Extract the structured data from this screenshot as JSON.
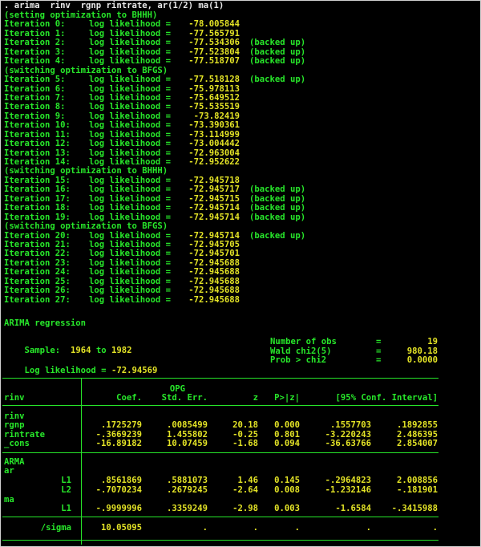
{
  "command": ". arima  rinv  rgnp rintrate, ar(1/2) ma(1)",
  "colors": {
    "background": "#000000",
    "command": "#e8e8e8",
    "text": "#27e62a",
    "result": "#e3e326"
  },
  "log_label": "log likelihood =",
  "backed_label": "(backed up)",
  "iteration_log": [
    {
      "kind": "header",
      "text": "(setting optimization to BHHH)"
    },
    {
      "kind": "iter",
      "label": "Iteration 0:",
      "value": "-78.005844",
      "backed": false
    },
    {
      "kind": "iter",
      "label": "Iteration 1:",
      "value": "-77.565791",
      "backed": false
    },
    {
      "kind": "iter",
      "label": "Iteration 2:",
      "value": "-77.534306",
      "backed": true
    },
    {
      "kind": "iter",
      "label": "Iteration 3:",
      "value": "-77.523804",
      "backed": true
    },
    {
      "kind": "iter",
      "label": "Iteration 4:",
      "value": "-77.518707",
      "backed": true
    },
    {
      "kind": "header",
      "text": "(switching optimization to BFGS)"
    },
    {
      "kind": "iter",
      "label": "Iteration 5:",
      "value": "-77.518128",
      "backed": true
    },
    {
      "kind": "iter",
      "label": "Iteration 6:",
      "value": "-75.978113",
      "backed": false
    },
    {
      "kind": "iter",
      "label": "Iteration 7:",
      "value": "-75.649512",
      "backed": false
    },
    {
      "kind": "iter",
      "label": "Iteration 8:",
      "value": "-75.535519",
      "backed": false
    },
    {
      "kind": "iter",
      "label": "Iteration 9:",
      "value": "-73.82419",
      "backed": false
    },
    {
      "kind": "iter",
      "label": "Iteration 10:",
      "value": "-73.390361",
      "backed": false
    },
    {
      "kind": "iter",
      "label": "Iteration 11:",
      "value": "-73.114999",
      "backed": false
    },
    {
      "kind": "iter",
      "label": "Iteration 12:",
      "value": "-73.004442",
      "backed": false
    },
    {
      "kind": "iter",
      "label": "Iteration 13:",
      "value": "-72.963004",
      "backed": false
    },
    {
      "kind": "iter",
      "label": "Iteration 14:",
      "value": "-72.952622",
      "backed": false
    },
    {
      "kind": "header",
      "text": "(switching optimization to BHHH)"
    },
    {
      "kind": "iter",
      "label": "Iteration 15:",
      "value": "-72.945718",
      "backed": false
    },
    {
      "kind": "iter",
      "label": "Iteration 16:",
      "value": "-72.945717",
      "backed": true
    },
    {
      "kind": "iter",
      "label": "Iteration 17:",
      "value": "-72.945715",
      "backed": true
    },
    {
      "kind": "iter",
      "label": "Iteration 18:",
      "value": "-72.945714",
      "backed": true
    },
    {
      "kind": "iter",
      "label": "Iteration 19:",
      "value": "-72.945714",
      "backed": true
    },
    {
      "kind": "header",
      "text": "(switching optimization to BFGS)"
    },
    {
      "kind": "iter",
      "label": "Iteration 20:",
      "value": "-72.945714",
      "backed": true
    },
    {
      "kind": "iter",
      "label": "Iteration 21:",
      "value": "-72.945705",
      "backed": false
    },
    {
      "kind": "iter",
      "label": "Iteration 22:",
      "value": "-72.945701",
      "backed": false
    },
    {
      "kind": "iter",
      "label": "Iteration 23:",
      "value": "-72.945688",
      "backed": false
    },
    {
      "kind": "iter",
      "label": "Iteration 24:",
      "value": "-72.945688",
      "backed": false
    },
    {
      "kind": "iter",
      "label": "Iteration 25:",
      "value": "-72.945688",
      "backed": false
    },
    {
      "kind": "iter",
      "label": "Iteration 26:",
      "value": "-72.945688",
      "backed": false
    },
    {
      "kind": "iter",
      "label": "Iteration 27:",
      "value": "-72.945688",
      "backed": false
    }
  ],
  "title": "ARIMA regression",
  "sample": {
    "label": "Sample:",
    "from": "1964",
    "to_word": "to",
    "to": "1982"
  },
  "loglik": {
    "label": "Log likelihood =",
    "value": "-72.94569"
  },
  "stats": [
    {
      "label": "Number of obs",
      "eq": "=",
      "value": "19"
    },
    {
      "label": "Wald chi2(5)",
      "eq": "=",
      "value": "980.18"
    },
    {
      "label": "Prob > chi2",
      "eq": "=",
      "value": "0.0000"
    }
  ],
  "table": {
    "opg_label": "OPG",
    "depvar": "rinv",
    "headers": [
      "Coef.",
      "Std. Err.",
      "z",
      "P>|z|",
      "[95% Conf. Interval]"
    ],
    "group1": {
      "name": "rinv",
      "rows": [
        {
          "var": "rgnp",
          "coef": ".1725279",
          "se": ".0085499",
          "z": "20.18",
          "p": "0.000",
          "lo": ".1557703",
          "hi": ".1892855"
        },
        {
          "var": "rintrate",
          "coef": "-.3669239",
          "se": "1.455802",
          "z": "-0.25",
          "p": "0.801",
          "lo": "-3.220243",
          "hi": "2.486395"
        },
        {
          "var": "_cons",
          "coef": "-16.89182",
          "se": "10.07459",
          "z": "-1.68",
          "p": "0.094",
          "lo": "-36.63766",
          "hi": "2.854007"
        }
      ]
    },
    "group2": {
      "name": "ARMA",
      "ar_label": "ar",
      "ar_rows": [
        {
          "var": "L1",
          "coef": ".8561869",
          "se": ".5881073",
          "z": "1.46",
          "p": "0.145",
          "lo": "-.2964823",
          "hi": "2.008856"
        },
        {
          "var": "L2",
          "coef": "-.7070234",
          "se": ".2679245",
          "z": "-2.64",
          "p": "0.008",
          "lo": "-1.232146",
          "hi": "-.181901"
        }
      ],
      "ma_label": "ma",
      "ma_rows": [
        {
          "var": "L1",
          "coef": "-.9999996",
          "se": ".3359249",
          "z": "-2.98",
          "p": "0.003",
          "lo": "-1.6584",
          "hi": "-.3415988"
        }
      ]
    },
    "sigma": {
      "var": "/sigma",
      "coef": "10.05095",
      "se": ".",
      "z": ".",
      "p": ".",
      "lo": ".",
      "hi": "."
    }
  }
}
